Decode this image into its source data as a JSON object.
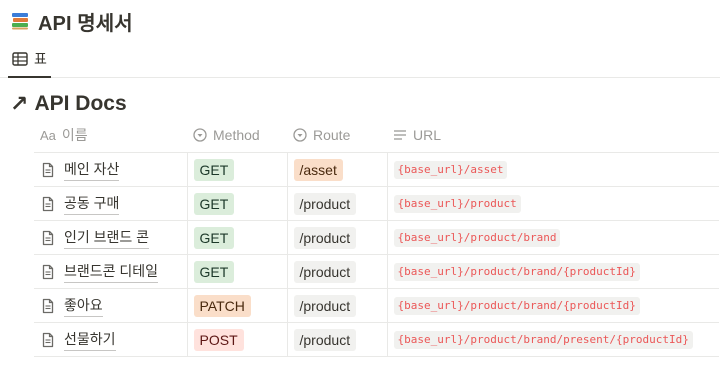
{
  "page": {
    "title": "API 명세서"
  },
  "view": {
    "tab_label": "표"
  },
  "database": {
    "title": "API Docs"
  },
  "columns": [
    {
      "label": "이름",
      "icon": "Aa"
    },
    {
      "label": "Method",
      "icon": "select-icon"
    },
    {
      "label": "Route",
      "icon": "select-icon"
    },
    {
      "label": "URL",
      "icon": "text-lines-icon"
    }
  ],
  "rows": [
    {
      "name": "메인 자산",
      "method": "GET",
      "route": "/asset",
      "url": "{base_url}/asset"
    },
    {
      "name": "공동 구매",
      "method": "GET",
      "route": "/product",
      "url": "{base_url}/product"
    },
    {
      "name": "인기 브랜드 콘",
      "method": "GET",
      "route": "/product",
      "url": "{base_url}/product/brand"
    },
    {
      "name": "브랜드콘 디테일",
      "method": "GET",
      "route": "/product",
      "url": "{base_url}/product/brand/{productId}"
    },
    {
      "name": "좋아요",
      "method": "PATCH",
      "route": "/product",
      "url": "{base_url}/product/brand/{productId}"
    },
    {
      "name": "선물하기",
      "method": "POST",
      "route": "/product",
      "url": "{base_url}/product/brand/present/{productId}"
    }
  ],
  "colors": {
    "GET": {
      "bg": "#dbeddb",
      "fg": "#1c3829"
    },
    "PATCH": {
      "bg": "#fadec9",
      "fg": "#49290e"
    },
    "POST": {
      "bg": "#ffe2dd",
      "fg": "#5d1715"
    },
    "route_asset": {
      "bg": "#fadec9",
      "fg": "#49290e"
    },
    "route_default": {
      "bg": "#f1f1ef",
      "fg": "#37352f"
    }
  }
}
